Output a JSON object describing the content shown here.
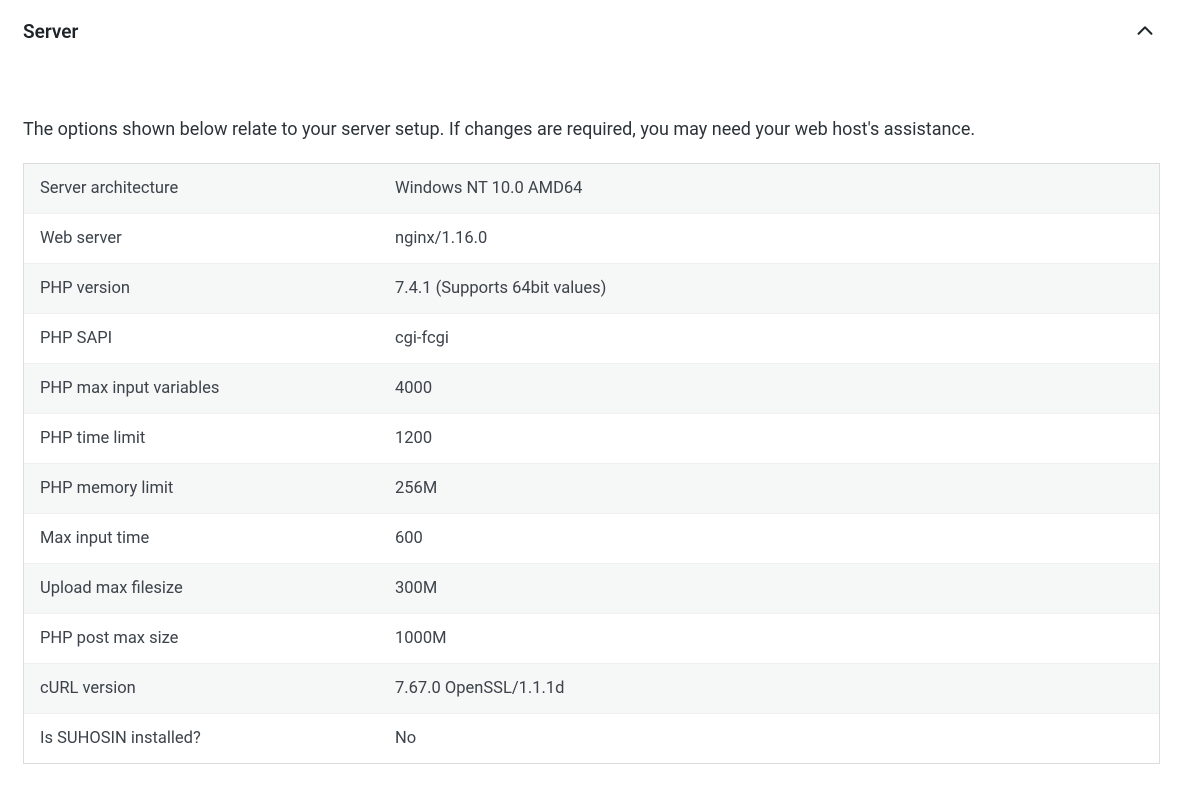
{
  "panel": {
    "title": "Server",
    "description": "The options shown below relate to your server setup. If changes are required, you may need your web host's assistance."
  },
  "rows": [
    {
      "label": "Server architecture",
      "value": "Windows NT 10.0 AMD64"
    },
    {
      "label": "Web server",
      "value": "nginx/1.16.0"
    },
    {
      "label": "PHP version",
      "value": "7.4.1 (Supports 64bit values)"
    },
    {
      "label": "PHP SAPI",
      "value": "cgi-fcgi"
    },
    {
      "label": "PHP max input variables",
      "value": "4000"
    },
    {
      "label": "PHP time limit",
      "value": "1200"
    },
    {
      "label": "PHP memory limit",
      "value": "256M"
    },
    {
      "label": "Max input time",
      "value": "600"
    },
    {
      "label": "Upload max filesize",
      "value": "300M"
    },
    {
      "label": "PHP post max size",
      "value": "1000M"
    },
    {
      "label": "cURL version",
      "value": "7.67.0 OpenSSL/1.1.1d"
    },
    {
      "label": "Is SUHOSIN installed?",
      "value": "No"
    }
  ]
}
